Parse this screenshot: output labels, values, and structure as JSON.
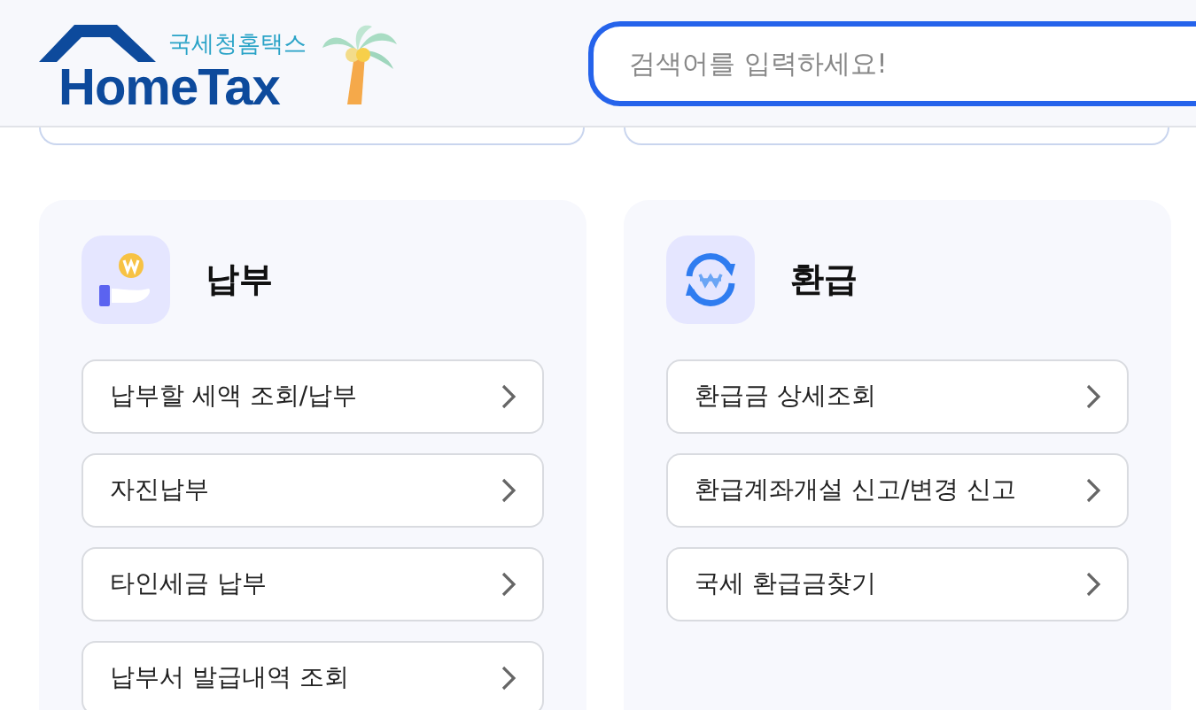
{
  "header": {
    "logo_caption": "국세청홈택스",
    "logo_title": "HomeTax",
    "search": {
      "placeholder": "검색어를 입력하세요!"
    }
  },
  "panels": [
    {
      "kind": "payment",
      "title": "납부",
      "items": [
        "납부할 세액 조회/납부",
        "자진납부",
        "타인세금 납부",
        "납부서 발급내역 조회"
      ]
    },
    {
      "kind": "refund",
      "title": "환급",
      "items": [
        "환급금 상세조회",
        "환급계좌개설 신고/변경 신고",
        "국세 환급금찾기"
      ]
    }
  ]
}
